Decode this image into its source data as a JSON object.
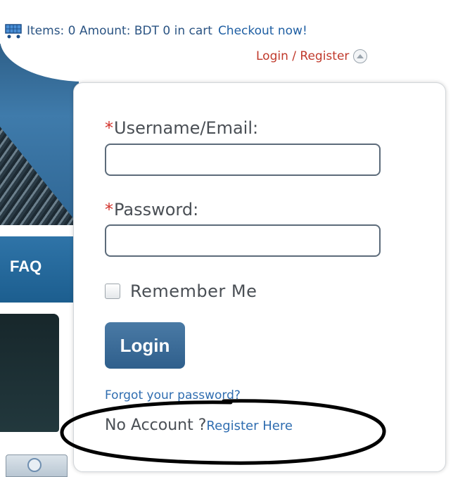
{
  "header": {
    "cart_summary": "Items: 0 Amount: BDT  0 in cart",
    "checkout_label": "Checkout now!",
    "login_register_label": "Login / Register",
    "cart_icon": "cart-icon",
    "toggle_icon": "chevron-up-icon"
  },
  "background": {
    "nav_label": "FAQ"
  },
  "login_form": {
    "required_mark": "*",
    "username_label": "Username/Email:",
    "username_value": "",
    "password_label": "Password:",
    "password_value": "",
    "remember_label": "Remember Me",
    "remember_checked": false,
    "login_button": "Login",
    "forgot_label": "Forgot your password?",
    "no_account_label": "No Account ?",
    "register_label": "Register Here"
  },
  "colors": {
    "accent": "#2f5f8c",
    "link": "#2f6db0",
    "required": "#d2332c",
    "login_register": "#c0392b"
  }
}
